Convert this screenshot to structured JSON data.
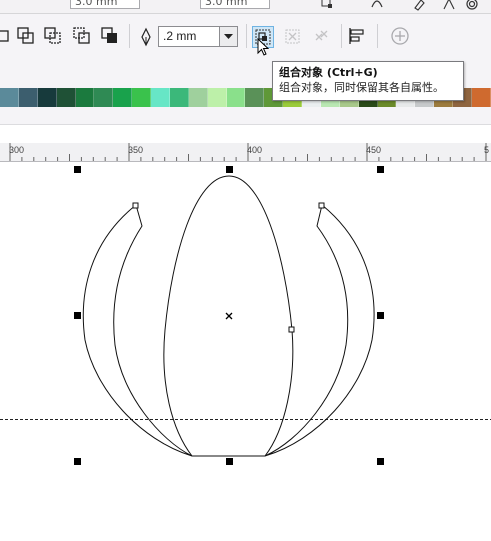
{
  "top_toolbar": {
    "field_left": "3.0 mm",
    "field_right": "3.0 mm"
  },
  "property_bar": {
    "outline_width": ".2 mm"
  },
  "tooltip": {
    "title": "组合对象 (Ctrl+G)",
    "description": "组合对象，同时保留其各自属性。"
  },
  "palette": {
    "colors": [
      "#5b8a9a",
      "#3c5e6e",
      "#173a3c",
      "#1f5136",
      "#1b7a3e",
      "#2f8a54",
      "#19a24c",
      "#3ac24c",
      "#67e6c6",
      "#3bb87a",
      "#9fd09d",
      "#bdf0a9",
      "#8ae08b",
      "#5a9158",
      "#5f9838",
      "#9acb3a",
      "#eaeef0",
      "#b9e7b2",
      "#a8c88a",
      "#2a4a18",
      "#6b8a2a",
      "#e7e9ea",
      "#c6c9cb",
      "#9c7b3e",
      "#8f6540",
      "#cf6a2f"
    ]
  },
  "ruler": {
    "labels": [
      "300",
      "350",
      "400",
      "450",
      "5"
    ]
  },
  "icons": [
    "pen-nib-icon",
    "group-objects-icon",
    "ungroup-icon",
    "ungroup-all-icon",
    "align-distribute-icon",
    "plus-circle-icon",
    "dropdown-arrow-icon",
    "cursor-arrow-icon"
  ]
}
